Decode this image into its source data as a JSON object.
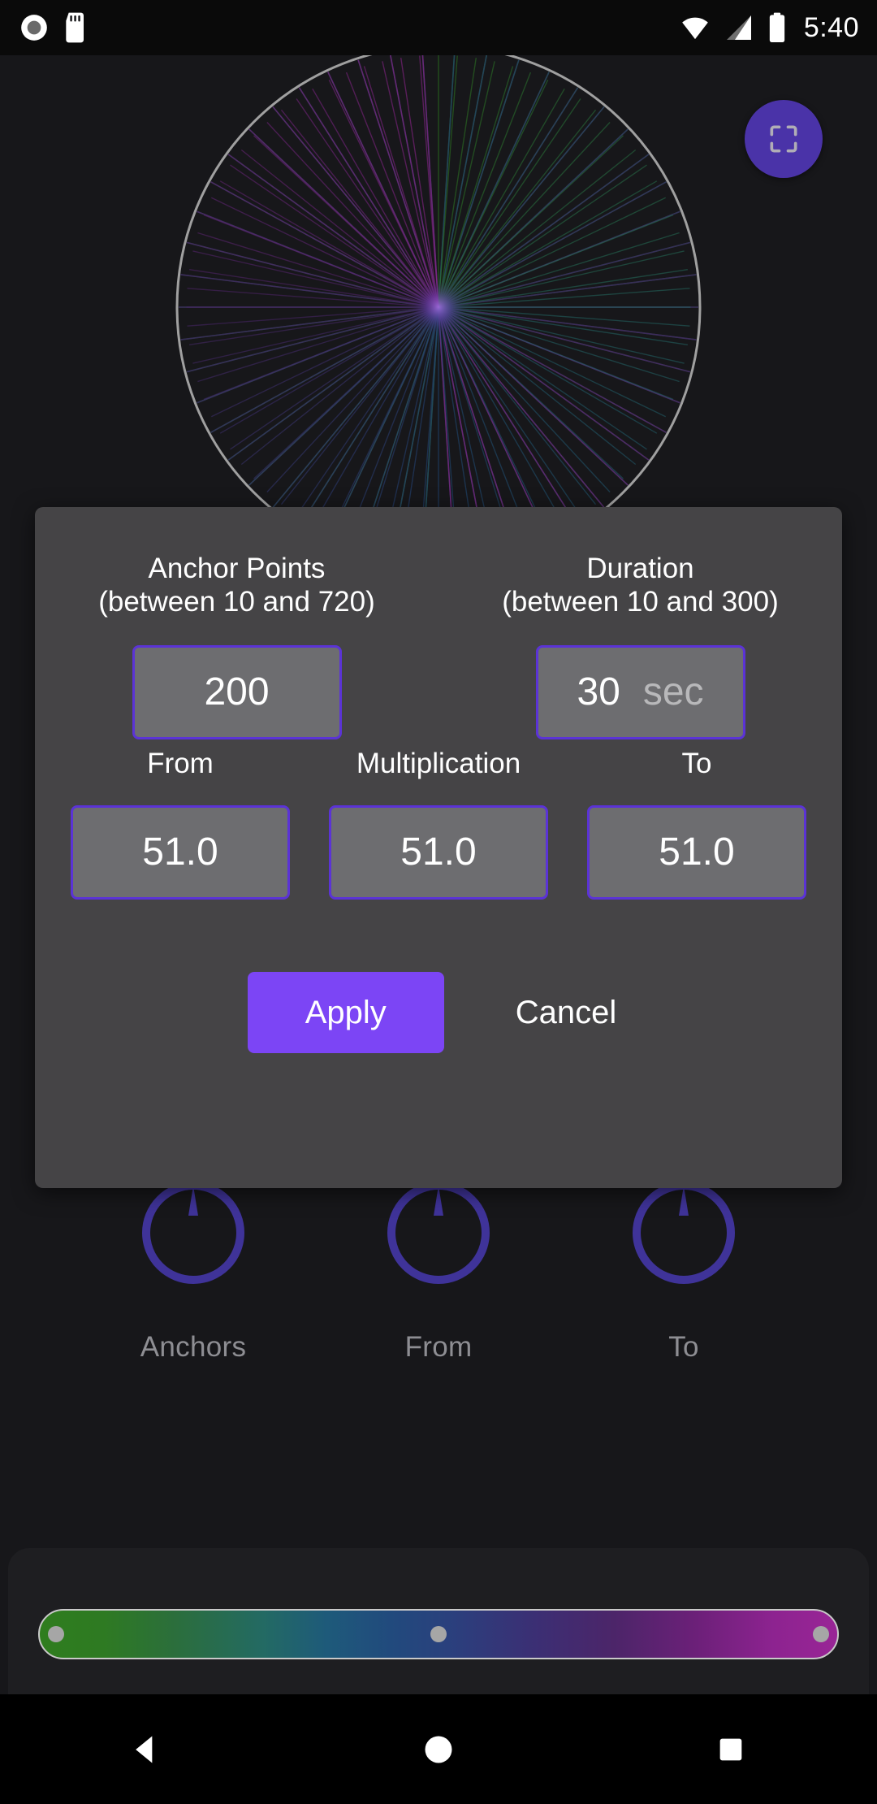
{
  "status_bar": {
    "icons": [
      "screen-record-icon",
      "sd-card-icon",
      "wifi-icon",
      "cellular-signal-icon",
      "battery-icon"
    ],
    "time": "5:40"
  },
  "viz": {
    "name": "times-table-string-art",
    "outer_circle_color": "#b9b9b9",
    "background": "#17171a",
    "line_colors": [
      "#2f7d1e",
      "#1e5a7a",
      "#3b2f74",
      "#8d2390"
    ]
  },
  "fullscreen_fab": {
    "icon": "fullscreen-icon",
    "background": "#4a33a8",
    "icon_color": "#b0adb6"
  },
  "dialog": {
    "anchor_points": {
      "label_line1": "Anchor Points",
      "label_line2": "(between 10 and 720)",
      "value": "200",
      "placeholder": "200"
    },
    "duration": {
      "label_line1": "Duration",
      "label_line2": "(between 10 and 300)",
      "value": "30",
      "unit": "sec",
      "placeholder": "30"
    },
    "from": {
      "label": "From",
      "value": "51.0",
      "placeholder": "51.0"
    },
    "multiplication": {
      "label": "Multiplication",
      "value": "51.0",
      "placeholder": "51.0"
    },
    "to": {
      "label": "To",
      "value": "51.0",
      "placeholder": "51.0"
    },
    "apply_label": "Apply",
    "cancel_label": "Cancel",
    "accent_color": "#5b33d6",
    "apply_color": "#7c45f5",
    "background": "#454446"
  },
  "knobs": [
    {
      "label": "Anchors",
      "name": "knob-anchors",
      "angle": 0
    },
    {
      "label": "From",
      "name": "knob-from",
      "angle": 0
    },
    {
      "label": "To",
      "name": "knob-to",
      "angle": 0
    }
  ],
  "gradient_bar": {
    "name": "color-gradient-slider",
    "handles": [
      {
        "name": "gradient-handle-start",
        "position_pct": 2
      },
      {
        "name": "gradient-handle-middle",
        "position_pct": 50
      },
      {
        "name": "gradient-handle-end",
        "position_pct": 98
      }
    ],
    "stops": [
      "#2f7d1e",
      "#236a63",
      "#214a7d",
      "#4c2569",
      "#992596"
    ]
  },
  "nav_bar": {
    "back_label": "back-icon",
    "home_label": "home-icon",
    "recents_label": "recents-icon"
  }
}
